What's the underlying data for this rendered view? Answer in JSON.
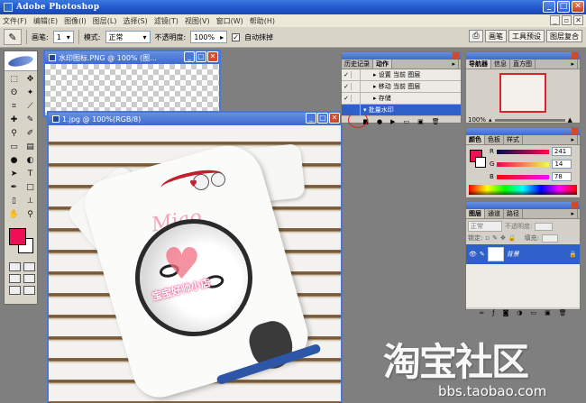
{
  "app": {
    "title": "Adobe Photoshop"
  },
  "menu": [
    "文件(F)",
    "编辑(E)",
    "图像(I)",
    "图层(L)",
    "选择(S)",
    "滤镜(T)",
    "视图(V)",
    "窗口(W)",
    "帮助(H)"
  ],
  "options": {
    "brush_label": "画笔:",
    "brush_size": "1",
    "mode_label": "模式:",
    "mode_value": "正常",
    "opacity_label": "不透明度:",
    "opacity_value": "100%",
    "auto_erase": "自动抹掉",
    "right_tabs": [
      "画笔",
      "工具预设",
      "图层复合"
    ]
  },
  "documents": {
    "watermark": {
      "title": "水印图标.PNG @ 100% (图..."
    },
    "main": {
      "title": "1.jpg @ 100%(RGB/8)"
    }
  },
  "photo": {
    "overlay_text": "宝宝好帅小店",
    "script_text": "Miao"
  },
  "actions_panel": {
    "tabs": [
      "历史记录",
      "动作"
    ],
    "active_tab": "动作",
    "rows": [
      {
        "label": "设置 当前 图层"
      },
      {
        "label": "移动 当前 图层"
      },
      {
        "label": "存储"
      },
      {
        "label": "批量水印"
      }
    ]
  },
  "navigator_panel": {
    "tabs": [
      "导航器",
      "信息",
      "直方图"
    ],
    "zoom": "100%"
  },
  "color_panel": {
    "tabs": [
      "颜色",
      "色板",
      "样式"
    ],
    "foreground": "#ef0f55",
    "channels": [
      {
        "label": "R",
        "value": "241"
      },
      {
        "label": "G",
        "value": "14"
      },
      {
        "label": "B",
        "value": "78"
      }
    ]
  },
  "layers_panel": {
    "tabs": [
      "图层",
      "通道",
      "路径"
    ],
    "blend_mode": "正常",
    "opacity_label": "不透明度:",
    "lock_label": "锁定:",
    "fill_label": "填充:",
    "layer_name": "背景"
  },
  "watermark_logo": {
    "text": "淘宝社区",
    "url": "bbs.taobao.com"
  },
  "colors": {
    "titlebar": "#2458cc",
    "selection": "#2f5fc8",
    "accent_red": "#ef0f55"
  }
}
